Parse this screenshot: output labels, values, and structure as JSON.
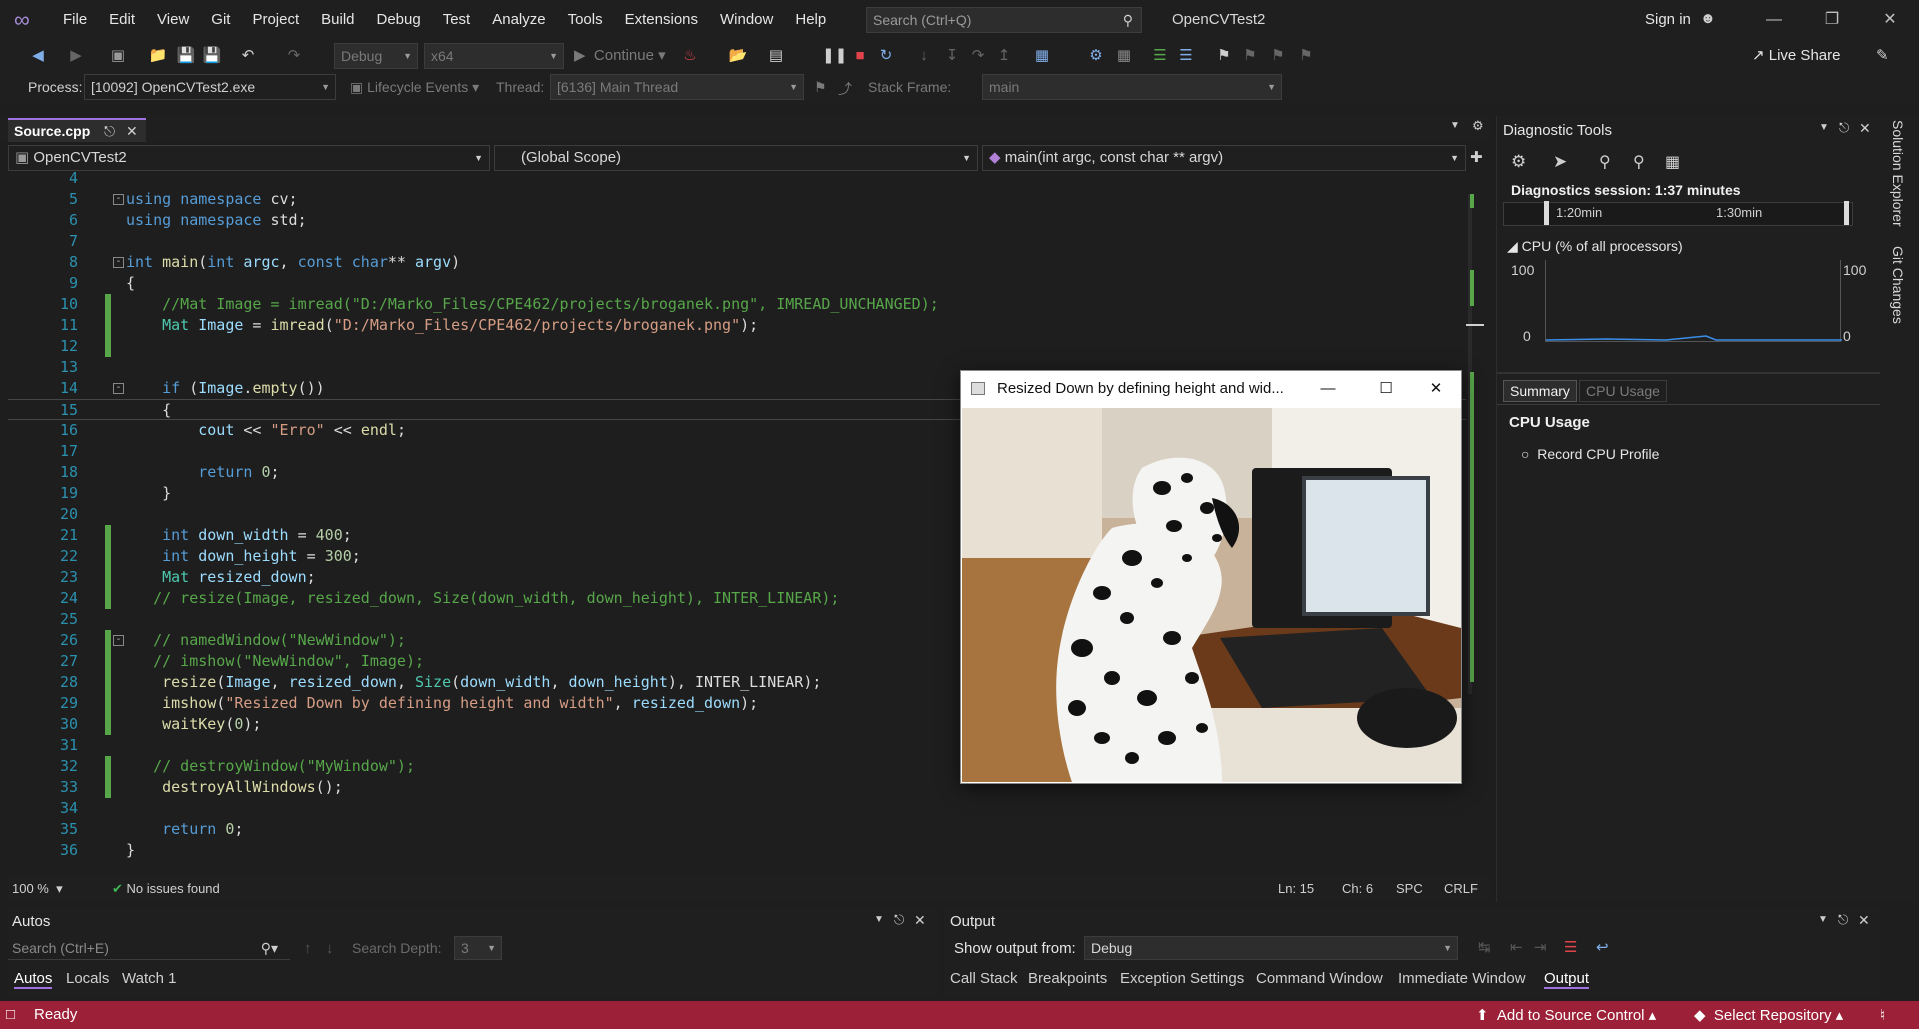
{
  "titlebar": {
    "menu": [
      "File",
      "Edit",
      "View",
      "Git",
      "Project",
      "Build",
      "Debug",
      "Test",
      "Analyze",
      "Tools",
      "Extensions",
      "Window",
      "Help"
    ],
    "search_placeholder": "Search (Ctrl+Q)",
    "solution_name": "OpenCVTest2",
    "sign_in": "Sign in"
  },
  "toolbar": {
    "config": "Debug",
    "platform": "x64",
    "continue": "Continue",
    "live_share": "Live Share"
  },
  "debugbar": {
    "process_label": "Process:",
    "process_value": "[10092] OpenCVTest2.exe",
    "lifecycle": "Lifecycle Events",
    "thread_label": "Thread:",
    "thread_value": "[6136] Main Thread",
    "stack_label": "Stack Frame:",
    "stack_value": "main"
  },
  "editor": {
    "tab": "Source.cpp",
    "nav_project": "OpenCVTest2",
    "nav_scope": "(Global Scope)",
    "nav_func": "main(int argc, const char ** argv)",
    "zoom": "100 %",
    "issues": "No issues found",
    "ln": "Ln: 15",
    "ch": "Ch: 6",
    "spc": "SPC",
    "crlf": "CRLF",
    "line_numbers": [
      "4",
      "5",
      "6",
      "7",
      "8",
      "9",
      "10",
      "11",
      "12",
      "13",
      "14",
      "15",
      "16",
      "17",
      "18",
      "19",
      "20",
      "21",
      "22",
      "23",
      "24",
      "25",
      "26",
      "27",
      "28",
      "29",
      "30",
      "31",
      "32",
      "33",
      "34",
      "35",
      "36"
    ]
  },
  "image_window": {
    "title": "Resized Down by defining height and wid..."
  },
  "diagnostics": {
    "title": "Diagnostic Tools",
    "session": "Diagnostics session: 1:37 minutes",
    "t1": "1:20min",
    "t2": "1:30min",
    "cpu_title": "CPU (% of all processors)",
    "cpu_max": "100",
    "cpu_min": "0",
    "tab_summary": "Summary",
    "tab_cpu": "CPU Usage",
    "cpu_usage_heading": "CPU Usage",
    "record": "Record CPU Profile",
    "side_solution": "Solution Explorer",
    "side_git": "Git Changes"
  },
  "autos": {
    "title": "Autos",
    "search_placeholder": "Search (Ctrl+E)",
    "depth_label": "Search Depth:",
    "depth_value": "3",
    "tabs": [
      "Autos",
      "Locals",
      "Watch 1"
    ]
  },
  "output": {
    "title": "Output",
    "show_from_label": "Show output from:",
    "show_from_value": "Debug",
    "tabs": [
      "Call Stack",
      "Breakpoints",
      "Exception Settings",
      "Command Window",
      "Immediate Window",
      "Output"
    ]
  },
  "statusbar": {
    "ready": "Ready",
    "source_control": "Add to Source Control",
    "repo": "Select Repository"
  }
}
